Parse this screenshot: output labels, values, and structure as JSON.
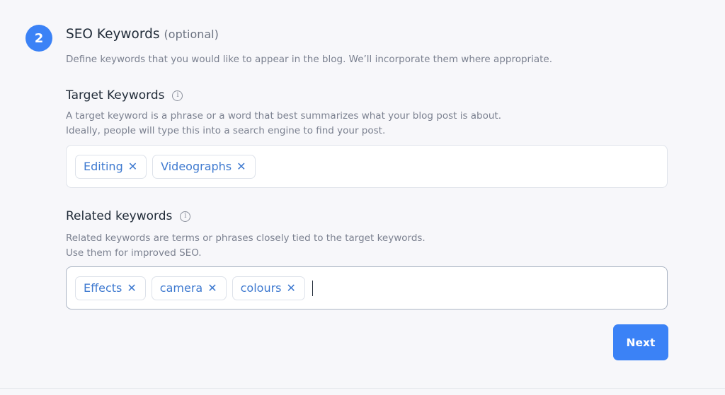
{
  "step": {
    "number": "2",
    "title": "SEO Keywords",
    "optional_label": "(optional)",
    "description": "Define keywords that you would like to appear in the blog. We’ll incorporate them where appropriate."
  },
  "target_keywords": {
    "label": "Target Keywords",
    "info_icon": "info-icon",
    "info_glyph": "i",
    "description_line1": "A target keyword is a phrase or a word that best summarizes what your blog post is about.",
    "description_line2": "Ideally, people will type this into a search engine to find your post.",
    "tags": [
      {
        "label": "Editing",
        "remove": "✕"
      },
      {
        "label": "Videographs",
        "remove": "✕"
      }
    ]
  },
  "related_keywords": {
    "label": "Related keywords",
    "info_icon": "info-icon",
    "info_glyph": "i",
    "description_line1": "Related keywords are terms or phrases closely tied to the target keywords.",
    "description_line2": "Use them for improved SEO.",
    "tags": [
      {
        "label": "Effects",
        "remove": "✕"
      },
      {
        "label": "camera",
        "remove": "✕"
      },
      {
        "label": "colours",
        "remove": "✕"
      }
    ],
    "input_value": ""
  },
  "actions": {
    "next_label": "Next"
  },
  "colors": {
    "accent": "#3b82f6",
    "chip_text": "#3f7ad0",
    "background": "#f7f7fa"
  }
}
